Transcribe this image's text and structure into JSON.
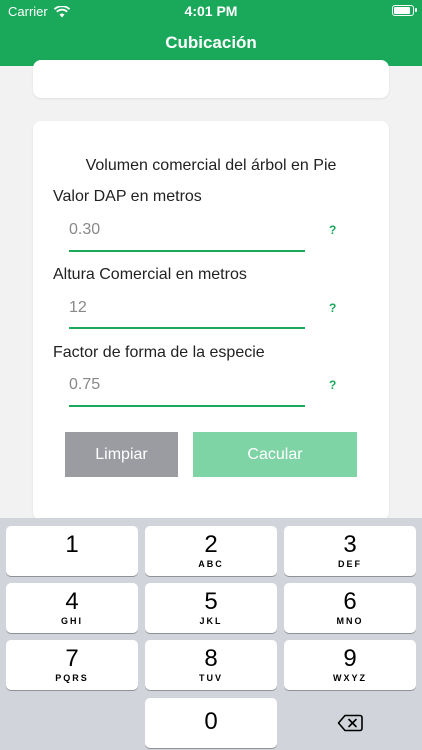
{
  "status": {
    "carrier": "Carrier",
    "time": "4:01 PM"
  },
  "nav": {
    "title": "Cubicación"
  },
  "form": {
    "heading": "Volumen comercial del árbol en Pie",
    "fields": [
      {
        "label": "Valor DAP en metros",
        "value": "0.30",
        "help": "?"
      },
      {
        "label": "Altura Comercial en metros",
        "value": "12",
        "help": "?"
      },
      {
        "label": "Factor de forma de la especie",
        "value": "0.75",
        "help": "?"
      }
    ],
    "clear_label": "Limpiar",
    "calc_label": "Cacular"
  },
  "keypad": {
    "keys": [
      {
        "num": "1",
        "letters": ""
      },
      {
        "num": "2",
        "letters": "ABC"
      },
      {
        "num": "3",
        "letters": "DEF"
      },
      {
        "num": "4",
        "letters": "GHI"
      },
      {
        "num": "5",
        "letters": "JKL"
      },
      {
        "num": "6",
        "letters": "MNO"
      },
      {
        "num": "7",
        "letters": "PQRS"
      },
      {
        "num": "8",
        "letters": "TUV"
      },
      {
        "num": "9",
        "letters": "WXYZ"
      },
      {
        "num": "0",
        "letters": ""
      }
    ],
    "backspace_icon": "backspace-icon"
  },
  "colors": {
    "primary": "#1aa85a",
    "button_disabled": "#7fd4a6",
    "button_secondary": "#9a9ca2"
  }
}
